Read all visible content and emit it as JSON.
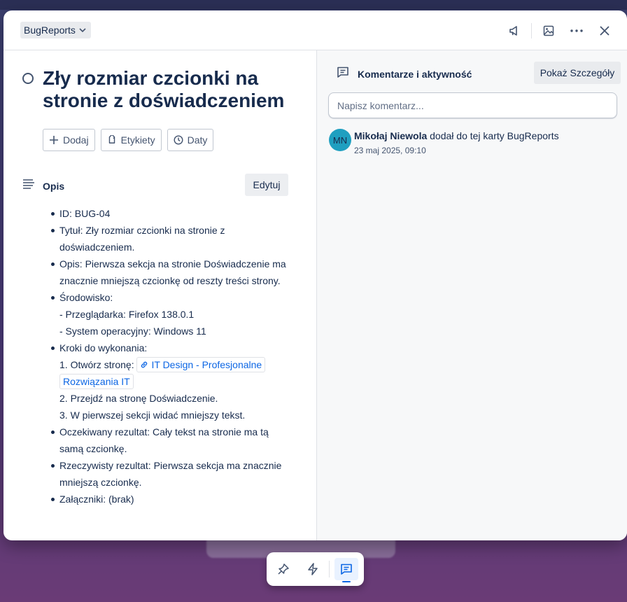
{
  "header": {
    "list_name": "BugReports",
    "icons": [
      "megaphone-icon",
      "image-icon",
      "more-icon",
      "close-icon"
    ]
  },
  "card": {
    "title": "Zły rozmiar czcionki na stronie z doświadczeniem",
    "actions": [
      {
        "label": "Dodaj",
        "icon": "plus-icon"
      },
      {
        "label": "Etykiety",
        "icon": "tag-icon"
      },
      {
        "label": "Daty",
        "icon": "clock-icon"
      }
    ]
  },
  "description": {
    "heading": "Opis",
    "edit_label": "Edytuj",
    "id_line": "ID: BUG-04",
    "title_line": "Tytuł: Zły rozmiar czcionki na stronie z doświadczeniem.",
    "desc_line": "Opis: Pierwsza sekcja na stronie Doświadczenie ma znacznie mniejszą czcionkę od reszty treści strony.",
    "env_heading": "Środowisko:",
    "env_browser": "- Przeglądarka: Firefox 138.0.1",
    "env_os": "- System operacyjny: Windows 11",
    "steps_heading": "Kroki do wykonania:",
    "step1_prefix": "1. Otwórz stronę:",
    "step1_link": "IT Design - Profesjonalne Rozwiązania IT",
    "step2": "2. Przejdź na stronę Doświadczenie.",
    "step3": "3. W pierwszej sekcji widać mniejszy tekst.",
    "expected": "Oczekiwany rezultat: Cały tekst na stronie ma tą samą czcionkę.",
    "actual": "Rzeczywisty rezultat: Pierwsza sekcja ma znacznie mniejszą czcionkę.",
    "attachments": "Załączniki: (brak)"
  },
  "comments": {
    "heading": "Komentarze i aktywność",
    "details_button": "Pokaż Szczegóły",
    "input_placeholder": "Napisz komentarz...",
    "activity": {
      "avatar_initials": "MN",
      "avatar_color": "#1f9fc0",
      "user": "Mikołaj Niewola",
      "action": " dodał do tej karty BugReports",
      "time": "23 maj 2025, 09:10"
    }
  },
  "bottom_bar": {
    "icons": [
      "pin-icon",
      "bolt-icon",
      "comment-icon"
    ],
    "active": "comment-icon"
  }
}
